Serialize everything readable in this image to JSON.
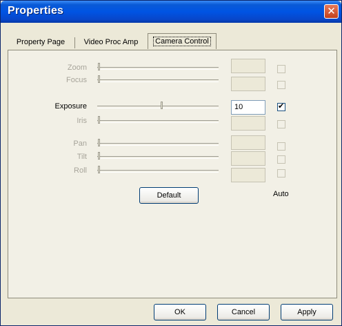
{
  "window": {
    "title": "Properties",
    "close_glyph": "✕"
  },
  "tabs": [
    {
      "label": "Property Page",
      "active": false
    },
    {
      "label": "Video Proc Amp",
      "active": false
    },
    {
      "label": "Camera Control",
      "active": true
    }
  ],
  "controls": [
    {
      "label": "Zoom",
      "enabled": false,
      "value": "",
      "auto": false,
      "level": 0
    },
    {
      "label": "Focus",
      "enabled": false,
      "value": "",
      "auto": false,
      "level": 0
    },
    {
      "label": "Exposure",
      "enabled": true,
      "value": "10",
      "auto": true,
      "level": 0.52
    },
    {
      "label": "Iris",
      "enabled": false,
      "value": "",
      "auto": false,
      "level": 0
    },
    {
      "label": "Pan",
      "enabled": false,
      "value": "",
      "auto": false,
      "level": 0
    },
    {
      "label": "Tilt",
      "enabled": false,
      "value": "",
      "auto": false,
      "level": 0
    },
    {
      "label": "Roll",
      "enabled": false,
      "value": "",
      "auto": false,
      "level": 0
    }
  ],
  "default_button": "Default",
  "auto_label": "Auto",
  "buttons": {
    "ok": "OK",
    "cancel": "Cancel",
    "apply": "Apply"
  },
  "colors": {
    "title_bar": "#0054e3",
    "dialog_bg": "#ece9d8",
    "disabled_text": "#a7a49a"
  }
}
